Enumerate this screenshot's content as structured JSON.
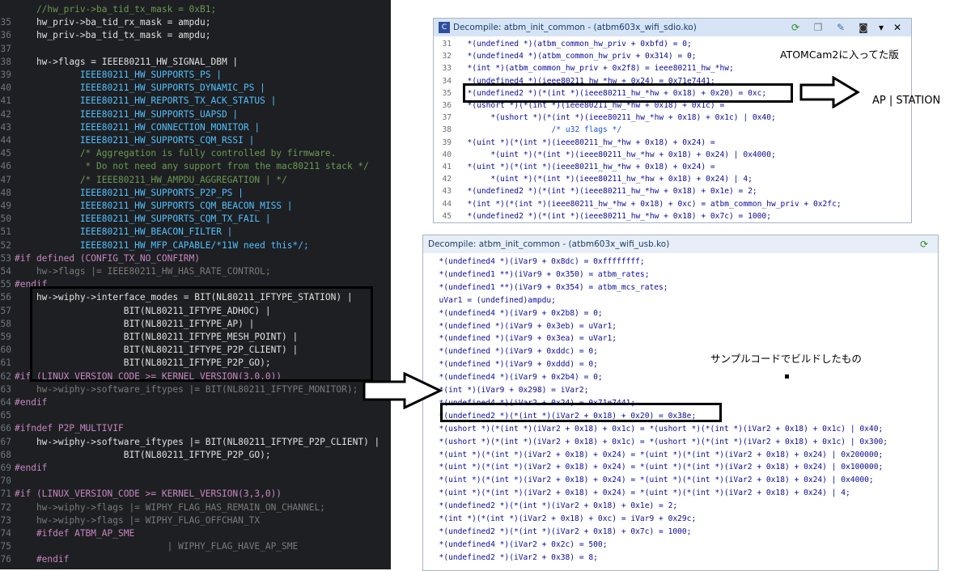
{
  "editor": {
    "lines": [
      {
        "n": "",
        "t": "    //hw_priv->ba_tid_tx_mask = 0xB1;",
        "cls": "kw-com"
      },
      {
        "n": "35",
        "t": "    hw_priv->ba_tid_rx_mask = ampdu;",
        "cls": ""
      },
      {
        "n": "36",
        "t": "    hw_priv->ba_tid_tx_mask = ampdu;",
        "cls": ""
      },
      {
        "n": "37",
        "t": "",
        "cls": ""
      },
      {
        "n": "38",
        "t": "    hw->flags = IEEE80211_HW_SIGNAL_DBM |",
        "cls": ""
      },
      {
        "n": "39",
        "t": "            IEEE80211_HW_SUPPORTS_PS |",
        "cls": "kw-def"
      },
      {
        "n": "40",
        "t": "            IEEE80211_HW_SUPPORTS_DYNAMIC_PS |",
        "cls": "kw-def"
      },
      {
        "n": "41",
        "t": "            IEEE80211_HW_REPORTS_TX_ACK_STATUS |",
        "cls": "kw-def"
      },
      {
        "n": "42",
        "t": "            IEEE80211_HW_SUPPORTS_UAPSD |",
        "cls": "kw-def"
      },
      {
        "n": "43",
        "t": "            IEEE80211_HW_CONNECTION_MONITOR |",
        "cls": "kw-def"
      },
      {
        "n": "44",
        "t": "            IEEE80211_HW_SUPPORTS_CQM_RSSI |",
        "cls": "kw-def"
      },
      {
        "n": "45",
        "t": "            /* Aggregation is fully controlled by firmware.",
        "cls": "kw-com"
      },
      {
        "n": "46",
        "t": "             * Do not need any support from the mac80211 stack */",
        "cls": "kw-com"
      },
      {
        "n": "47",
        "t": "            /* IEEE80211_HW_AMPDU_AGGREGATION | */",
        "cls": "kw-com"
      },
      {
        "n": "48",
        "t": "            IEEE80211_HW_SUPPORTS_P2P_PS |",
        "cls": "kw-def"
      },
      {
        "n": "49",
        "t": "            IEEE80211_HW_SUPPORTS_CQM_BEACON_MISS |",
        "cls": "kw-def"
      },
      {
        "n": "50",
        "t": "            IEEE80211_HW_SUPPORTS_CQM_TX_FAIL |",
        "cls": "kw-def"
      },
      {
        "n": "51",
        "t": "            IEEE80211_HW_BEACON_FILTER |",
        "cls": "kw-def"
      },
      {
        "n": "52",
        "t": "            IEEE80211_HW_MFP_CAPABLE/*11W need this*/;",
        "cls": "kw-def"
      },
      {
        "n": "53",
        "t": "#if defined (CONFIG_TX_NO_CONFIRM)",
        "cls": "kw-macro"
      },
      {
        "n": "54",
        "t": "    hw->flags |= IEEE80211_HW_HAS_RATE_CONTROL;",
        "cls": "kw-dim"
      },
      {
        "n": "55",
        "t": "#endif",
        "cls": "kw-macro"
      },
      {
        "n": "56",
        "t": "    hw->wiphy->interface_modes = BIT(NL80211_IFTYPE_STATION) |",
        "cls": ""
      },
      {
        "n": "57",
        "t": "                    BIT(NL80211_IFTYPE_ADHOC) |",
        "cls": ""
      },
      {
        "n": "58",
        "t": "                    BIT(NL80211_IFTYPE_AP) |",
        "cls": ""
      },
      {
        "n": "59",
        "t": "                    BIT(NL80211_IFTYPE_MESH_POINT) |",
        "cls": ""
      },
      {
        "n": "60",
        "t": "                    BIT(NL80211_IFTYPE_P2P_CLIENT) |",
        "cls": ""
      },
      {
        "n": "61",
        "t": "                    BIT(NL80211_IFTYPE_P2P_GO);",
        "cls": ""
      },
      {
        "n": "62",
        "t": "#if (LINUX_VERSION_CODE >= KERNEL_VERSION(3,0,0))",
        "cls": "kw-macro"
      },
      {
        "n": "63",
        "t": "    hw->wiphy->software_iftypes |= BIT(NL80211_IFTYPE_MONITOR);",
        "cls": "kw-dim"
      },
      {
        "n": "64",
        "t": "#endif",
        "cls": "kw-macro"
      },
      {
        "n": "65",
        "t": "",
        "cls": ""
      },
      {
        "n": "66",
        "t": "#ifndef P2P_MULTIVIF",
        "cls": "kw-macro"
      },
      {
        "n": "67",
        "t": "    hw->wiphy->software_iftypes |= BIT(NL80211_IFTYPE_P2P_CLIENT) |",
        "cls": ""
      },
      {
        "n": "68",
        "t": "                    BIT(NL80211_IFTYPE_P2P_GO);",
        "cls": ""
      },
      {
        "n": "69",
        "t": "#endif",
        "cls": "kw-macro"
      },
      {
        "n": "70",
        "t": "",
        "cls": ""
      },
      {
        "n": "71",
        "t": "#if (LINUX_VERSION_CODE >= KERNEL_VERSION(3,3,0))",
        "cls": "kw-macro"
      },
      {
        "n": "72",
        "t": "    hw->wiphy->flags |= WIPHY_FLAG_HAS_REMAIN_ON_CHANNEL;",
        "cls": "kw-dim"
      },
      {
        "n": "73",
        "t": "    hw->wiphy->flags |= WIPHY_FLAG_OFFCHAN_TX",
        "cls": "kw-dim"
      },
      {
        "n": "74",
        "t": "    #ifdef ATBM_AP_SME",
        "cls": "kw-macro"
      },
      {
        "n": "75",
        "t": "                            | WIPHY_FLAG_HAVE_AP_SME",
        "cls": "kw-dim"
      },
      {
        "n": "76",
        "t": "    #endif",
        "cls": "kw-macro"
      }
    ]
  },
  "top_window": {
    "title": "Decompile: atbm_init_common -  (atbm603x_wifi_sdio.ko)",
    "icon_label": "C",
    "annotation": "ATOMCam2に入ってた版",
    "side_label": "AP | STATION",
    "lines": [
      {
        "n": "31",
        "t": "  *(undefined *)(atbm_common_hw_priv + 0xbfd) = 0;"
      },
      {
        "n": "32",
        "t": "  *(undefined4 *)(atbm_common_hw_priv + 0x314) = 0;"
      },
      {
        "n": "33",
        "t": "  *(int *)(atbm_common_hw_priv + 0x2f8) = ieee80211_hw_*hw;"
      },
      {
        "n": "34",
        "t": "  *(undefined4 *)(ieee80211_hw_*hw + 0x24) = 0x71e7441;"
      },
      {
        "n": "35",
        "t": "  *(undefined2 *)(*(int *)(ieee80211_hw_*hw + 0x18) + 0x20) = 0xc;"
      },
      {
        "n": "36",
        "t": "  *(ushort *)(*(int *)(ieee80211_hw_*hw + 0x18) + 0x1c) ="
      },
      {
        "n": "37",
        "t": "       *(ushort *)(*(int *)(ieee80211_hw_*hw + 0x18) + 0x1c) | 0x40;"
      },
      {
        "n": "38",
        "t": "                    /* u32 flags */"
      },
      {
        "n": "39",
        "t": "  *(uint *)(*(int *)(ieee80211_hw_*hw + 0x18) + 0x24) ="
      },
      {
        "n": "40",
        "t": "       *(uint *)(*(int *)(ieee80211_hw_*hw + 0x18) + 0x24) | 0x4000;"
      },
      {
        "n": "41",
        "t": "  *(uint *)(*(int *)(ieee80211_hw_*hw + 0x18) + 0x24) ="
      },
      {
        "n": "42",
        "t": "       *(uint *)(*(int *)(ieee80211_hw_*hw + 0x18) + 0x24) | 4;"
      },
      {
        "n": "43",
        "t": "  *(undefined2 *)(*(int *)(ieee80211_hw_*hw + 0x18) + 0x1e) = 2;"
      },
      {
        "n": "44",
        "t": "  *(int *)(*(int *)(ieee80211_hw_*hw + 0x18) + 0xc) = atbm_common_hw_priv + 0x2fc;"
      },
      {
        "n": "45",
        "t": "  *(undefined2 *)(*(int *)(ieee80211_hw_*hw + 0x18) + 0x7c) = 1000;"
      }
    ]
  },
  "bottom_window": {
    "title": "Decompile: atbm_init_common -  (atbm603x_wifi_usb.ko)",
    "annotation": "サンプルコードでビルドしたもの",
    "lines": [
      {
        "n": "",
        "t": "  *(undefined4 *)(iVar9 + 0x8dc) = 0xffffffff;"
      },
      {
        "n": "",
        "t": "  *(undefined1 **)(iVar9 + 0x350) = atbm_rates;"
      },
      {
        "n": "",
        "t": "  *(undefined1 **)(iVar9 + 0x354) = atbm_mcs_rates;"
      },
      {
        "n": "",
        "t": "  uVar1 = (undefined)ampdu;"
      },
      {
        "n": "",
        "t": "  *(undefined4 *)(iVar9 + 0x2b8) = 0;"
      },
      {
        "n": "",
        "t": "  *(undefined *)(iVar9 + 0x3eb) = uVar1;"
      },
      {
        "n": "",
        "t": "  *(undefined *)(iVar9 + 0x3ea) = uVar1;"
      },
      {
        "n": "",
        "t": "  *(undefined *)(iVar9 + 0xddc) = 0;"
      },
      {
        "n": "",
        "t": "  *(undefined *)(iVar9 + 0xddd) = 0;"
      },
      {
        "n": "",
        "t": "  *(undefined4 *)(iVar9 + 0x2b4) = 0;"
      },
      {
        "n": "",
        "t": "  *(int *)(iVar9 + 0x298) = iVar2;"
      },
      {
        "n": "",
        "t": "  *(undefined4 *)(iVar2 + 0x24) = 0x71e7441;"
      },
      {
        "n": "",
        "t": "  *(undefined2 *)(*(int *)(iVar2 + 0x18) + 0x20) = 0x38e;"
      },
      {
        "n": "",
        "t": "  *(ushort *)(*(int *)(iVar2 + 0x18) + 0x1c) = *(ushort *)(*(int *)(iVar2 + 0x18) + 0x1c) | 0x40;"
      },
      {
        "n": "",
        "t": "  *(ushort *)(*(int *)(iVar2 + 0x18) + 0x1c) = *(ushort *)(*(int *)(iVar2 + 0x18) + 0x1c) | 0x300;"
      },
      {
        "n": "",
        "t": "  *(uint *)(*(int *)(iVar2 + 0x18) + 0x24) = *(uint *)(*(int *)(iVar2 + 0x18) + 0x24) | 0x200000;"
      },
      {
        "n": "",
        "t": "  *(uint *)(*(int *)(iVar2 + 0x18) + 0x24) = *(uint *)(*(int *)(iVar2 + 0x18) + 0x24) | 0x100000;"
      },
      {
        "n": "",
        "t": "  *(uint *)(*(int *)(iVar2 + 0x18) + 0x24) = *(uint *)(*(int *)(iVar2 + 0x18) + 0x24) | 0x4000;"
      },
      {
        "n": "",
        "t": "  *(uint *)(*(int *)(iVar2 + 0x18) + 0x24) = *(uint *)(*(int *)(iVar2 + 0x18) + 0x24) | 4;"
      },
      {
        "n": "",
        "t": "  *(undefined2 *)(*(int *)(iVar2 + 0x18) + 0x1e) = 2;"
      },
      {
        "n": "",
        "t": "  *(int *)(*(int *)(iVar2 + 0x18) + 0xc) = iVar9 + 0x29c;"
      },
      {
        "n": "",
        "t": "  *(undefined2 *)(*(int *)(iVar2 + 0x18) + 0x7c) = 1000;"
      },
      {
        "n": "",
        "t": "  *(undefined4 *)(iVar2 + 0x2c) = 500;"
      },
      {
        "n": "",
        "t": "  *(undefined2 *)(iVar2 + 0x38) = 8;"
      }
    ]
  },
  "colors": {
    "editor_bg": "#1e1f22",
    "window_title_bg": "#d6e4f5",
    "box": "#000000"
  }
}
